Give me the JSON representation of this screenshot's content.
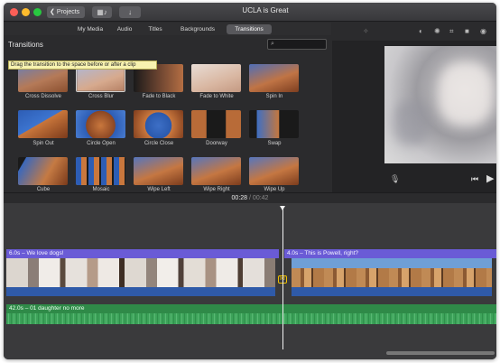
{
  "window": {
    "title": "UCLA is Great",
    "projects_label": "Projects"
  },
  "tabs": [
    {
      "label": "My Media",
      "active": false
    },
    {
      "label": "Audio",
      "active": false
    },
    {
      "label": "Titles",
      "active": false
    },
    {
      "label": "Backgrounds",
      "active": false
    },
    {
      "label": "Transitions",
      "active": true
    }
  ],
  "browser": {
    "title": "Transitions",
    "search_placeholder": "",
    "tooltip": "Drag the transition to the space before or after a clip",
    "items": [
      {
        "label": "Cross Dissolve"
      },
      {
        "label": "Cross Blur"
      },
      {
        "label": "Fade to Black"
      },
      {
        "label": "Fade to White"
      },
      {
        "label": "Spin In"
      },
      {
        "label": "Spin Out"
      },
      {
        "label": "Circle Open"
      },
      {
        "label": "Circle Close"
      },
      {
        "label": "Doorway"
      },
      {
        "label": "Swap"
      },
      {
        "label": "Cube"
      },
      {
        "label": "Mosaic"
      },
      {
        "label": "Wipe Left"
      },
      {
        "label": "Wipe Right"
      },
      {
        "label": "Wipe Up"
      }
    ]
  },
  "timeline": {
    "current_time": "00:28",
    "separator": "/",
    "total_time": "00:42",
    "clips": [
      {
        "title": "6.0s – We love dogs!"
      },
      {
        "title": "4.0s – This is Powell, right?"
      }
    ],
    "audio": {
      "title": "42.0s – 01 daughter no more"
    },
    "transition_marker": "⋈"
  },
  "colors": {
    "clip_title": "#6a5bd6",
    "audio": "#2f8a48",
    "clip_base": "#2f5aa8",
    "accent_yellow": "#f0c000"
  },
  "icons": {
    "microphone": "microphone-icon",
    "previous": "skip-back-icon",
    "play": "play-icon"
  }
}
